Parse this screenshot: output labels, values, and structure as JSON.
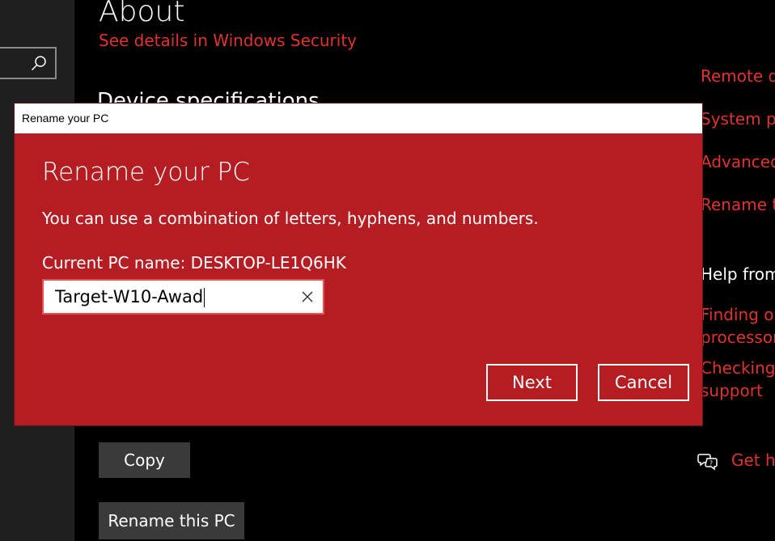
{
  "page": {
    "title": "About",
    "see_details_link": "See details in Windows Security",
    "section_heading": "Device specifications"
  },
  "sidebar": {
    "search_icon": "search-icon"
  },
  "right_panel": {
    "links": [
      "Remote de",
      "System pro",
      "Advanced",
      "Rename th"
    ],
    "help_heading": "Help from",
    "help_links": [
      {
        "line1": "Finding ou",
        "line2": "processor"
      },
      {
        "line1": "Checking",
        "line2": "support"
      }
    ],
    "get_help": "Get he"
  },
  "buttons": {
    "copy": "Copy",
    "rename": "Rename this PC"
  },
  "dialog": {
    "window_title": "Rename your PC",
    "heading": "Rename your PC",
    "description": "You can use a combination of letters, hyphens, and numbers.",
    "current_name": "Current PC name: DESKTOP-LE1Q6HK",
    "input_value": "Target-W10-Awad",
    "next_label": "Next",
    "cancel_label": "Cancel"
  },
  "colors": {
    "accent_red": "#b51d23",
    "link_red": "#e0332f"
  }
}
